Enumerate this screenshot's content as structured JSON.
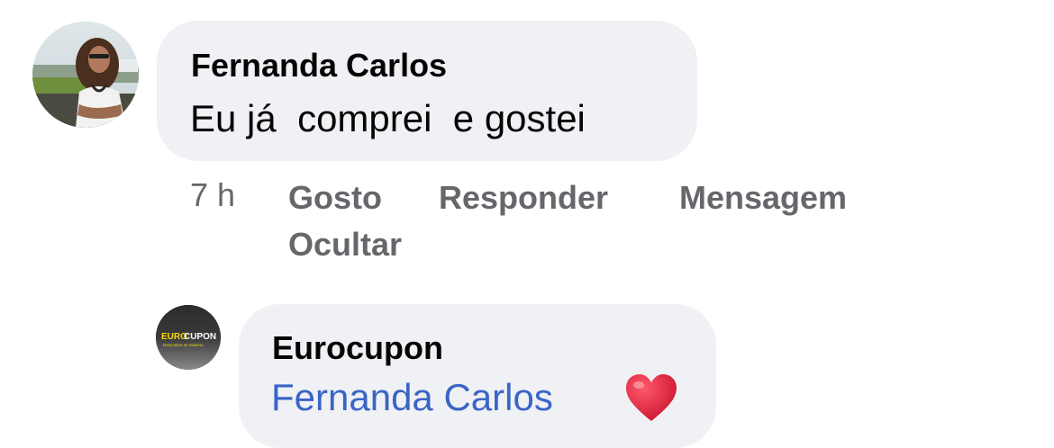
{
  "comment": {
    "author": "Fernanda Carlos",
    "text": "Eu já  comprei  e gostei",
    "time": "7 h",
    "actions": {
      "like": "Gosto",
      "reply": "Responder",
      "message": "Mensagem",
      "hide": "Ocultar"
    }
  },
  "reply": {
    "author": "Eurocupon",
    "mention": "Fernanda Carlos",
    "emoji": "heart-icon",
    "avatar_logo": {
      "euro": "EURO",
      "cupon": "CUPON",
      "tagline": "Descontos ao máximo"
    }
  },
  "colors": {
    "bubble": "#f0f1f4",
    "meta_text": "#65676b",
    "mention": "#3a64c7",
    "heart": "#e0243b",
    "logo_yellow": "#f5d90a"
  }
}
